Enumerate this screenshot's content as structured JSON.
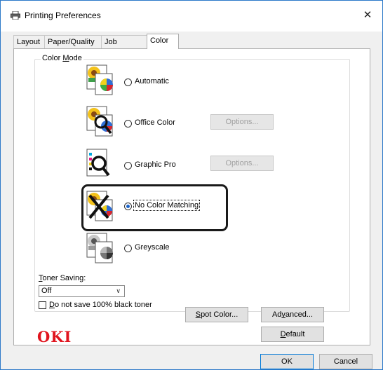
{
  "window": {
    "title": "Printing Preferences",
    "close_label": "✕"
  },
  "tabs": [
    {
      "label": "Layout"
    },
    {
      "label": "Paper/Quality"
    },
    {
      "label": "Job Options"
    },
    {
      "label": "Color",
      "active": true
    }
  ],
  "color_mode": {
    "legend": "Color Mode",
    "options": [
      {
        "label": "Automatic",
        "selected": false,
        "icon": "automatic-color-icon"
      },
      {
        "label": "Office Color",
        "selected": false,
        "icon": "office-color-icon",
        "options_button": "Options...",
        "options_enabled": false
      },
      {
        "label": "Graphic Pro",
        "selected": false,
        "icon": "graphic-pro-icon",
        "options_button": "Options...",
        "options_enabled": false
      },
      {
        "label": "No Color Matching",
        "selected": true,
        "icon": "no-color-matching-icon"
      },
      {
        "label": "Greyscale",
        "selected": false,
        "icon": "greyscale-icon"
      }
    ]
  },
  "toner_saving": {
    "label": "Toner Saving:",
    "value": "Off"
  },
  "black_toner_checkbox": {
    "label": "Do not save 100% black toner",
    "checked": false
  },
  "buttons": {
    "spot_color": "Spot Color...",
    "advanced": "Advanced...",
    "default": "Default",
    "ok": "OK",
    "cancel": "Cancel"
  },
  "logo": "OKI",
  "colors": {
    "accent": "#1a62c7",
    "logo": "#e0141e",
    "window_border": "#2c79c9"
  }
}
